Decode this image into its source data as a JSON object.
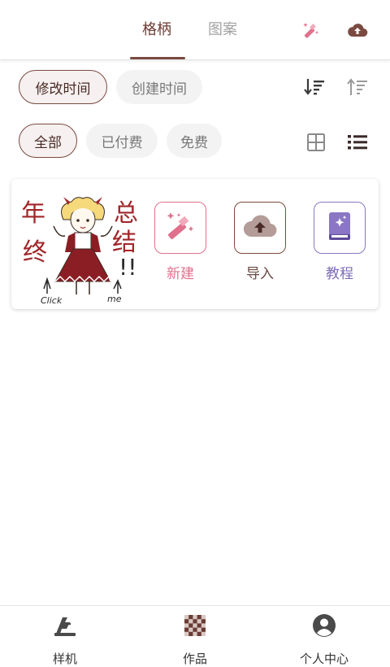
{
  "header": {
    "tabs": [
      {
        "label": "格柄",
        "active": true
      },
      {
        "label": "图案",
        "active": false
      }
    ],
    "icons": [
      "magic-wand-icon",
      "cloud-upload-icon"
    ]
  },
  "sort": {
    "options": [
      {
        "label": "修改时间",
        "selected": true
      },
      {
        "label": "创建时间",
        "selected": false
      }
    ],
    "order_icons": [
      "sort-descending-icon",
      "sort-ascending-icon"
    ]
  },
  "filter": {
    "options": [
      {
        "label": "全部",
        "selected": true
      },
      {
        "label": "已付费",
        "selected": false
      },
      {
        "label": "免费",
        "selected": false
      }
    ],
    "view_icons": [
      "grid-view-icon",
      "list-view-icon"
    ]
  },
  "card": {
    "banner": {
      "text_left_top": "年",
      "text_left_bottom": "终",
      "text_right_top": "总",
      "text_right_bottom": "结",
      "exclaim": "!!",
      "caption_left": "Click",
      "caption_right": "me"
    },
    "actions": [
      {
        "label": "新建",
        "icon": "magic-wand-icon",
        "color": "#e0708c"
      },
      {
        "label": "导入",
        "icon": "cloud-upload-icon",
        "color": "#7a4a40"
      },
      {
        "label": "教程",
        "icon": "book-icon",
        "color": "#8a76c4"
      }
    ]
  },
  "bottom_nav": {
    "items": [
      {
        "label": "样机",
        "icon": "machine-icon"
      },
      {
        "label": "作品",
        "icon": "checkerboard-icon"
      },
      {
        "label": "个人中心",
        "icon": "profile-icon"
      }
    ]
  },
  "colors": {
    "accent_brown": "#7a4a40",
    "pink": "#e0708c",
    "purple": "#8a76c4",
    "banner_red": "#a0262a"
  }
}
